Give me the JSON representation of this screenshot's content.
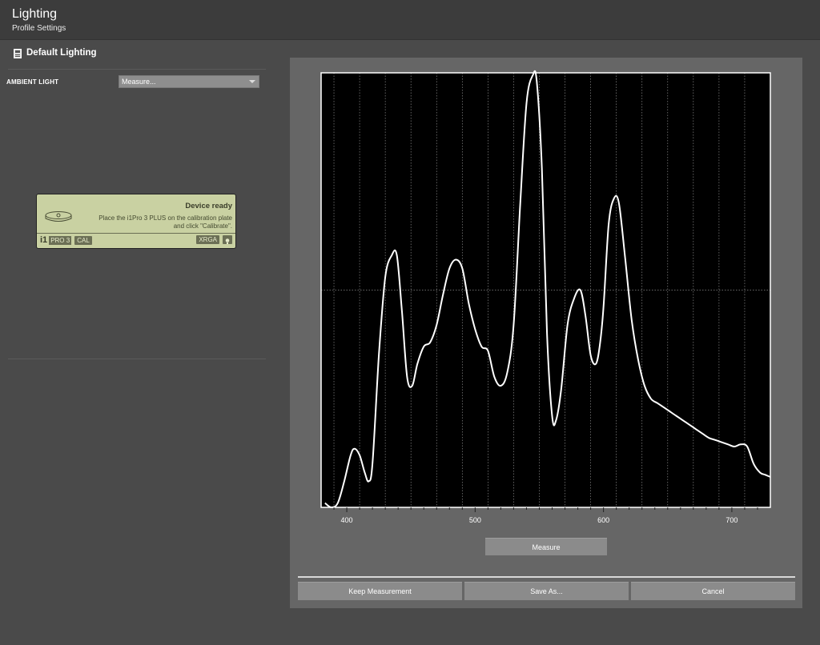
{
  "header": {
    "title": "Lighting",
    "subtitle": "Profile Settings"
  },
  "section": {
    "title": "Default Lighting",
    "icon": "document-icon"
  },
  "ambient": {
    "label": "AMBIENT LIGHT",
    "select_value": "Measure..."
  },
  "device": {
    "status": "Device ready",
    "instruction_line1": "Place the i1Pro 3 PLUS on the calibration plate",
    "instruction_line2": "and click \"Calibrate\".",
    "brand_i1": "i1",
    "brand_model": "PRO 3",
    "cal_tag": "CAL",
    "xrga_tag": "XRGA",
    "panel_color": "#c9d1a2"
  },
  "buttons": {
    "measure": "Measure",
    "keep": "Keep Measurement",
    "save_as": "Save As...",
    "cancel": "Cancel"
  },
  "chart_data": {
    "type": "line",
    "title": "",
    "xlabel": "",
    "ylabel": "",
    "xlim": [
      380,
      730
    ],
    "ylim": [
      0,
      1
    ],
    "x_ticks": [
      400,
      500,
      600,
      700
    ],
    "grid": true,
    "series": [
      {
        "x": [
          383,
          388,
          393,
          398,
          403,
          406,
          410,
          414,
          417,
          420,
          425,
          430,
          435,
          439,
          443,
          447,
          451,
          455,
          460,
          465,
          470,
          475,
          480,
          485,
          490,
          495,
          500,
          505,
          510,
          515,
          520,
          525,
          530,
          535,
          540,
          545,
          548,
          552,
          556,
          560,
          563,
          567,
          572,
          577,
          582,
          586,
          590,
          594,
          597,
          600,
          604,
          608,
          612,
          617,
          622,
          627,
          632,
          637,
          642,
          647,
          652,
          657,
          662,
          667,
          672,
          677,
          682,
          687,
          692,
          697,
          702,
          707,
          712,
          717,
          722,
          726,
          730
        ],
        "y": [
          0.01,
          0.0,
          0.01,
          0.06,
          0.12,
          0.135,
          0.12,
          0.08,
          0.06,
          0.1,
          0.35,
          0.53,
          0.58,
          0.58,
          0.45,
          0.3,
          0.28,
          0.33,
          0.37,
          0.38,
          0.42,
          0.49,
          0.55,
          0.57,
          0.55,
          0.47,
          0.41,
          0.37,
          0.36,
          0.3,
          0.28,
          0.31,
          0.42,
          0.69,
          0.93,
          0.995,
          0.98,
          0.78,
          0.4,
          0.21,
          0.2,
          0.27,
          0.42,
          0.48,
          0.5,
          0.44,
          0.35,
          0.33,
          0.37,
          0.46,
          0.65,
          0.71,
          0.7,
          0.57,
          0.43,
          0.34,
          0.28,
          0.25,
          0.24,
          0.23,
          0.22,
          0.21,
          0.2,
          0.19,
          0.18,
          0.17,
          0.16,
          0.155,
          0.15,
          0.145,
          0.14,
          0.145,
          0.14,
          0.1,
          0.08,
          0.075,
          0.07
        ],
        "color": "#ffffff"
      }
    ]
  }
}
